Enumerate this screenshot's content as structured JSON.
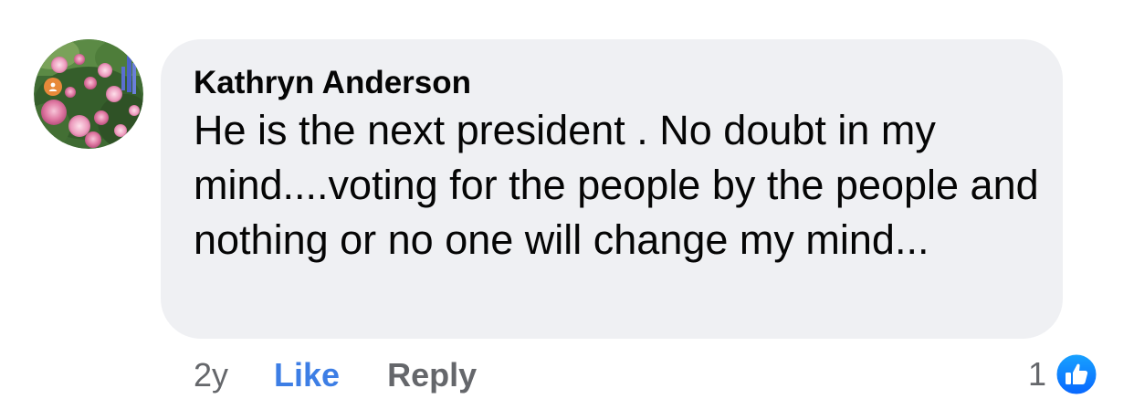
{
  "comment": {
    "author": "Kathryn Anderson",
    "text": "He is the next president .  No doubt in my mind....voting for the people by the people and nothing or no one will change my mind...",
    "avatar_icon": "profile-photo-flowers",
    "status_icon": "person-badge-icon"
  },
  "actions": {
    "timestamp": "2y",
    "like_label": "Like",
    "reply_label": "Reply"
  },
  "reactions": {
    "count": "1",
    "icon": "thumbs-up-icon"
  },
  "colors": {
    "bubble_bg": "#eff0f3",
    "like_blue": "#3d7ee5",
    "muted_text": "#65676b",
    "primary_text": "#050505",
    "status_orange": "#e8893a"
  }
}
